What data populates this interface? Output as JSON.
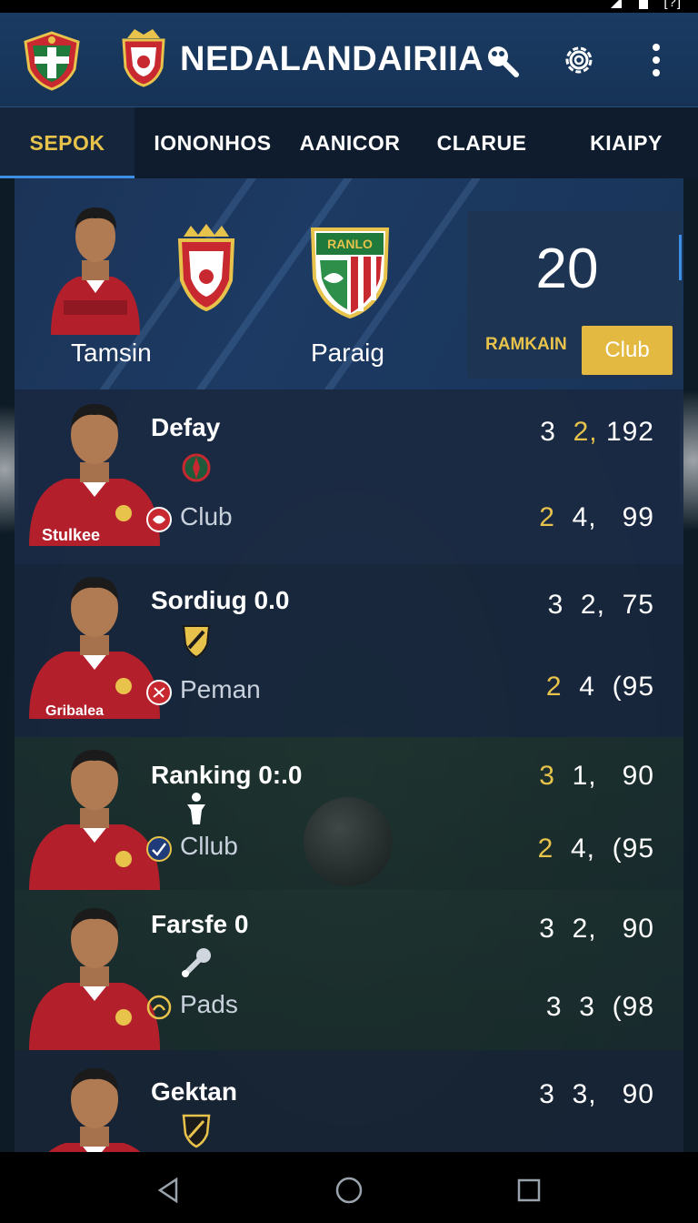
{
  "status_bar": {
    "time": "[?]"
  },
  "app_bar": {
    "title": "NEDALANDAIRIIA",
    "icons": {
      "app": "club-crest-icon",
      "brand": "crest-icon",
      "search": "search-icon",
      "settings": "gear-icon",
      "more": "more-vertical-icon"
    }
  },
  "tabs": [
    {
      "label": "SEPOK",
      "active": true
    },
    {
      "label": "IONONHOS",
      "active": false
    },
    {
      "label": "AANICOR",
      "active": false
    },
    {
      "label": "CLARUE",
      "active": false
    },
    {
      "label": "KIAIPY",
      "active": false
    }
  ],
  "match": {
    "home": {
      "name": "Tamsin"
    },
    "away": {
      "name": "Paraig",
      "crest_text": "RANLO"
    },
    "score": "20",
    "label": "RAMKAIN",
    "button": "Club"
  },
  "players": [
    {
      "name": "Defay",
      "jersey_text": "Stulkee",
      "sub": "Club",
      "stat_top": {
        "a": "3",
        "b": "2,",
        "c": "192"
      },
      "stat_bottom": {
        "a": "2",
        "b": "4,",
        "c": "99"
      }
    },
    {
      "name": "Sordiug 0.0",
      "jersey_text": "Gribalea",
      "sub": "Peman",
      "stat_top": {
        "a": "3",
        "b": "2,",
        "c": "75"
      },
      "stat_bottom": {
        "a": "2",
        "b": "4",
        "c": "(95"
      }
    },
    {
      "name": "Ranking 0:.0",
      "jersey_text": "",
      "sub": "Cllub",
      "stat_top": {
        "a": "3",
        "b": "1,",
        "c": "90"
      },
      "stat_bottom": {
        "a": "2",
        "b": "4,",
        "c": "(95"
      }
    },
    {
      "name": "Farsfe 0",
      "jersey_text": "",
      "sub": "Pads",
      "stat_top": {
        "a": "3",
        "b": "2,",
        "c": "90"
      },
      "stat_bottom": {
        "a": "3",
        "b": "3",
        "c": "(98"
      }
    },
    {
      "name": "Gektan",
      "jersey_text": "",
      "sub": "",
      "stat_top": {
        "a": "3",
        "b": "3,",
        "c": "90"
      },
      "stat_bottom": {
        "a": "",
        "b": "",
        "c": ""
      }
    }
  ],
  "colors": {
    "accent": "#e8c34b",
    "tab_indicator": "#3d8fe6",
    "app_bar": "#1a3b63",
    "jersey": "#b3202c"
  }
}
